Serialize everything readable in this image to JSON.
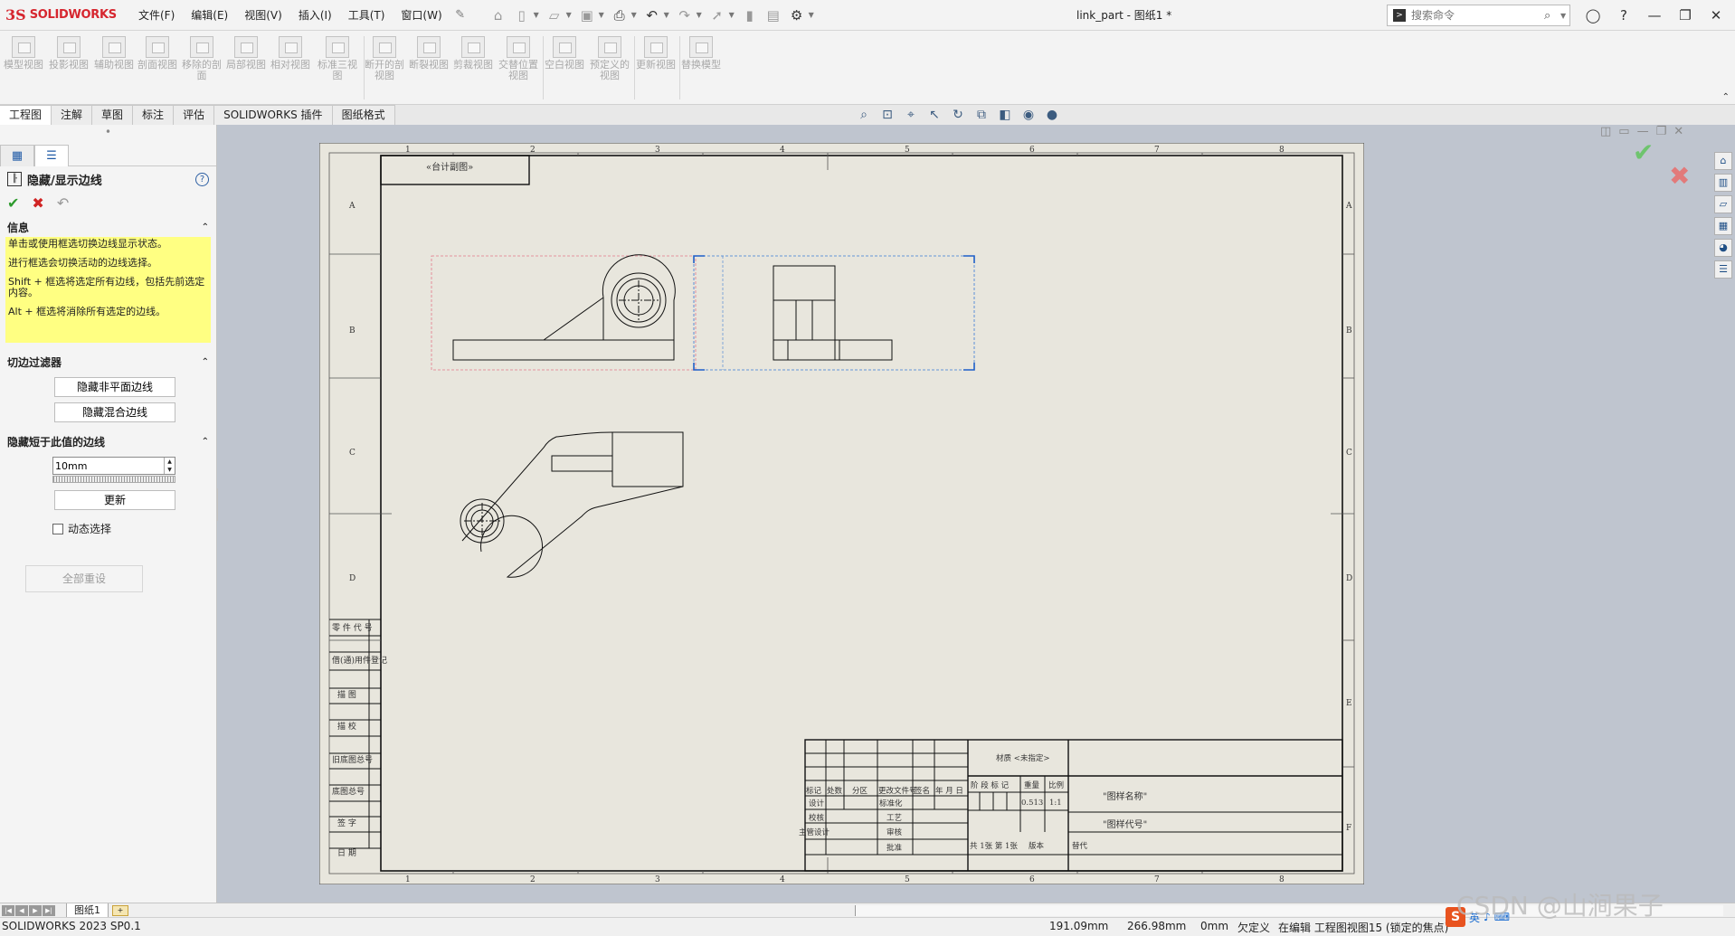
{
  "app": {
    "logo_ds": "3S",
    "logo_text": "SOLIDWORKS",
    "document_title": "link_part - 图纸1 *",
    "search_placeholder": "搜索命令",
    "menus": [
      "文件(F)",
      "编辑(E)",
      "视图(V)",
      "插入(I)",
      "工具(T)",
      "窗口(W)"
    ]
  },
  "ribbon": {
    "tools": [
      {
        "label": "模型视图"
      },
      {
        "label": "投影视图"
      },
      {
        "label": "辅助视图"
      },
      {
        "label": "剖面视图"
      },
      {
        "label": "移除的剖面"
      },
      {
        "label": "局部视图"
      },
      {
        "label": "相对视图"
      },
      {
        "label": "标准三视图"
      },
      {
        "label": "断开的剖视图"
      },
      {
        "label": "断裂视图"
      },
      {
        "label": "剪裁视图"
      },
      {
        "label": "交替位置视图"
      },
      {
        "label": "空白视图"
      },
      {
        "label": "预定义的视图"
      },
      {
        "label": "更新视图"
      },
      {
        "label": "替换模型"
      }
    ]
  },
  "tabs": [
    "工程图",
    "注解",
    "草图",
    "标注",
    "评估",
    "SOLIDWORKS 插件",
    "图纸格式"
  ],
  "property_manager": {
    "title": "隐藏/显示边线",
    "info_title": "信息",
    "info_lines": [
      "单击或使用框选切换边线显示状态。",
      "进行框选会切换活动的边线选择。",
      "Shift + 框选将选定所有边线，包括先前选定内容。",
      "Alt + 框选将消除所有选定的边线。"
    ],
    "tangent_filter_title": "切边过滤器",
    "hide_nonplanar": "隐藏非平面边线",
    "hide_blend": "隐藏混合边线",
    "hide_shorter_title": "隐藏短于此值的边线",
    "length_value": "10mm",
    "update": "更新",
    "dynamic_select": "动态选择",
    "reset_all": "全部重设"
  },
  "sheet": {
    "col_labels": [
      "1",
      "2",
      "3",
      "4",
      "5",
      "6",
      "7",
      "8"
    ],
    "row_labels": [
      "A",
      "B",
      "C",
      "D",
      "E",
      "F"
    ],
    "top_left_box": "«台计副图»",
    "left_strip": [
      "零 件 代 号",
      "借(通)用件登记",
      "描 图",
      "描 校",
      "旧底图总号",
      "底图总号",
      "签 字",
      "日 期"
    ],
    "title_block": {
      "material": "材质 <未指定>",
      "drawing_name": "\"图样名称\"",
      "drawing_code": "\"图样代号\"",
      "header_cols": [
        "标记",
        "处数",
        "分区",
        "更改文件号",
        "签名",
        "年 月 日"
      ],
      "stage_mark": "阶 段 标 记",
      "weight": "重量",
      "scale": "比例",
      "weight_value": "0.513",
      "scale_value": "1:1",
      "design": "设计",
      "standardize": "标准化",
      "check": "校核",
      "process": "工艺",
      "main_design": "主管设计",
      "review": "审核",
      "approve": "批准",
      "sheets": "共 1张 第 1张",
      "version": "版本",
      "replace": "替代"
    }
  },
  "sheet_tab": "图纸1",
  "status": {
    "version": "SOLIDWORKS 2023 SP0.1",
    "x": "191.09mm",
    "y": "266.98mm",
    "z": "0mm",
    "defined": "欠定义",
    "editing": "在编辑 工程图视图15 (锁定的焦点)",
    "watermark": "CSDN @山涧果子"
  }
}
